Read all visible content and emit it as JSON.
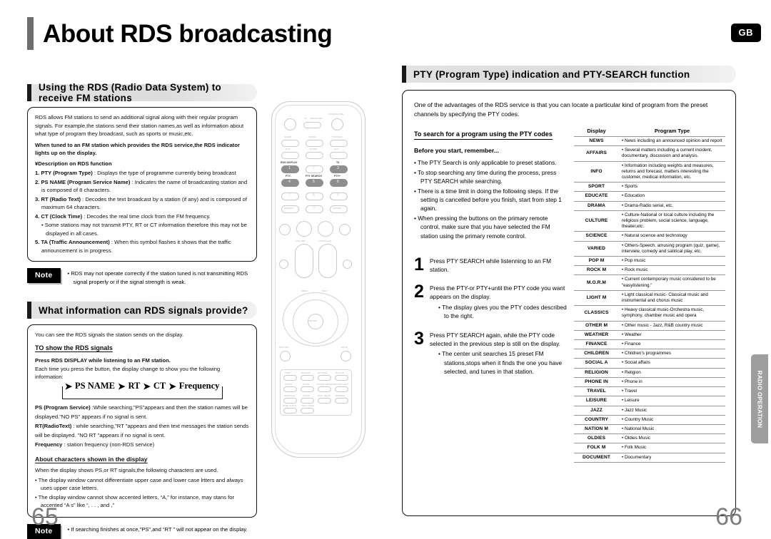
{
  "header": {
    "title": "About RDS broadcasting",
    "region_badge": "GB"
  },
  "side_tab": {
    "label": "RADIO OPERATION"
  },
  "footer": {
    "page_left": "65",
    "page_right": "66"
  },
  "left_column": {
    "section1": {
      "heading": "Using the RDS (Radio Data System) to receive FM stations",
      "intro1": "RDS allows FM stations to send an additional signal along with their regular program signals. For example,the stations send their station names,as well as information about what  type of program they broadcast, such as sports or music,etc.",
      "intro2": "When tuned to an FM station which provides the RDS service,the RDS indicator lights up on the display.",
      "desc_heading": "¥Description on RDS function",
      "items": [
        {
          "num": "1.",
          "bold": "PTY (Program Type)",
          "text": " : Displays the type of programme currently being broadcast"
        },
        {
          "num": "2.",
          "bold": "PS NAME (Program Service Name)",
          "text": " : Indicates the name of broadcasting station and is composed of 8 characters."
        },
        {
          "num": "3.",
          "bold": "RT (Radio Text)",
          "text": " : Decodes the text broadcast by a station (if any) and is composed of maximum 64 characters."
        },
        {
          "num": "4.",
          "bold": "CT (Clock Time)",
          "text": " : Decodes the real time clock from the FM frequency."
        }
      ],
      "sub_item": "• Some stations may not transmit PTY, RT or CT information therefore this may not be displayed in all cases.",
      "item5": {
        "num": "5.",
        "bold": "TA (Traffic Announcement)",
        "text": " : When this symbol flashes it shows that the traffic announcement is in progress."
      },
      "note_label": "Note",
      "note_text": "• RDS may not operate correctly if the station tuned is not transmitting RDS signal properly or if the signal strength is weak."
    },
    "section2": {
      "heading": "What information can RDS signals provide?",
      "intro": "You can see the RDS signals the station sends on the display.",
      "sub_head_1": "TO show the RDS signals",
      "press_line": "Press RDS DISPLAY while listening to an FM station.",
      "press_sub": "Each time you press the button, the display change to show you the following information:",
      "flow": [
        "PS NAME",
        "RT",
        "CT",
        "Frequency"
      ],
      "ps_bold": "PS (Program Service)",
      "ps_text": " :While searching,\"PS\"appears and then the station names will be displayed.\"NO PS\" appears if no signal is sent.",
      "rt_bold": "RT(RadioText)",
      "rt_text": " : while searching,\"RT \"appears and then text messages the station sends will be displayed. \"NO RT \"appears if no signal is sent.",
      "freq_bold": "Frequency",
      "freq_text": " : station frequency (non-RDS service)",
      "sub_head_2": "About characters shown in the display",
      "chars_intro": "When the display shows PS,or RT signals,the following characters are used.",
      "chars_b1": "• The display window cannot differentiate upper case and lower case lrtters and always uses upper case letters.",
      "chars_b2": "• The display window  cannot show accented letters, “A,” for instance, may stans for accented “A s” like “,  .  .  ,  and                    ,”",
      "note_label": "Note",
      "note_text": "• If searching finishes at once,\"PS\",and “RT ” will not appear on the display."
    }
  },
  "remote": {
    "top_labels": [
      "OPEN/CLOSE",
      "TV",
      "RECEIVER"
    ],
    "row_labels_1": [
      "SLEEP",
      "MODE",
      "TV/VIDEO"
    ],
    "row_labels_1b": [
      "DVD",
      "TUNER",
      "AUX"
    ],
    "highlight_labels": [
      "RDS DISPLAY",
      "TA",
      "PTY-",
      "PTY SEARCH",
      "PTY+"
    ],
    "numbers": [
      "1",
      "2",
      "3",
      "4",
      "5",
      "6",
      "7",
      "8",
      "9",
      "0"
    ],
    "extra_labels": [
      "REMAIN",
      "CANCEL",
      "VOLUME",
      "TUNING/CH",
      "RETURN",
      "MUTE",
      "ENTER",
      "MENU",
      "INFO"
    ],
    "bottom_labels": [
      "STEP",
      "REPEAT",
      "EZ VIEW",
      "P/SCAN",
      "ZOOM",
      "SLOW",
      "TUNER MEMORY",
      "SOUND EDIT",
      "SUBTITLE",
      "AUDIO",
      "DISC MENU",
      "DIMMER",
      "HDMI AUDIO",
      "TEST TONE"
    ]
  },
  "right_column": {
    "heading": "PTY (Program Type) indication and PTY-SEARCH function",
    "intro": "One  of the advantages of the RDS service is that you can locate a particular kind of program from the preset channels by specifying the PTY codes.",
    "sub_head": "To search for a program using the PTY codes",
    "before_head": "Before you start, remember...",
    "before_bullets": [
      "• The PTY Search is only applicable to preset stations.",
      "• To stop searching any time during the process, press PTY SEARCH while searching.",
      "• There is a time limit in doing the following steps. If the setting is cancelled before you finish, start from step 1 again.",
      "• When pressing the buttons on the primary remote control, make sure that you have selected the FM station using the primary remote control."
    ],
    "steps": [
      {
        "num": "1",
        "text": "Press PTY SEARCH while listenning to an FM station.",
        "sub": []
      },
      {
        "num": "2",
        "text": "Press the PTY-or PTY+until the PTY code you want appears on the display.",
        "sub": [
          "• The display gives you the PTY codes described to the right."
        ]
      },
      {
        "num": "3",
        "text": "Press PTY SEARCH again, while the PTY code selected in the previous step is still on the display.",
        "sub": [
          "• The center unit searches 15 preset FM stations,stops when it finds the one you have selected, and tunes in that station."
        ]
      }
    ],
    "table": {
      "headers": [
        "Display",
        "Program Type"
      ],
      "rows": [
        [
          "NEWS",
          "• News including an announced opinion and report"
        ],
        [
          "AFFAIRS",
          "• Several matters including a current incident, documentary, discussion and analysis."
        ],
        [
          "INFO",
          "•  Information including weights and measures, returns and forecast, matters interesting the customer, medical information, etc."
        ],
        [
          "SPORT",
          "• Sports"
        ],
        [
          "EDUCATE",
          "• Education"
        ],
        [
          "DRAMA",
          "• Drama-Radio serial, etc."
        ],
        [
          "CULTURE",
          "• Culture-National or local culture including the religious problem, social science, language, theater,etc."
        ],
        [
          "SCIENCE",
          "• Natural science and technology"
        ],
        [
          "VARIED",
          "• Others-Speech, amusing program (quiz, game), interview, comedy and satirical play, etc."
        ],
        [
          "POP M",
          "• Pop music"
        ],
        [
          "ROCK M",
          "• Rock music"
        ],
        [
          "M.O.R.M",
          "• Current contemporary music considered to be “easylistening.”"
        ],
        [
          "LIGHT M",
          "• Light classical music- Classical music and instrumental and chorus music"
        ],
        [
          "CLASSICS",
          "• Heavy classical  music-Orchestra music, symphony, chamber music and opera"
        ],
        [
          "OTHER M",
          "• Other music - Jazz, R&B country music"
        ],
        [
          "WEATHER",
          "• Weather"
        ],
        [
          "FINANCE",
          "• Finance"
        ],
        [
          "CHILDREN",
          "• Children’s programmes"
        ],
        [
          "SOCIAL A",
          "• Social affairs"
        ],
        [
          "RELIGION",
          "• Religion"
        ],
        [
          "PHONE IN",
          "• Phone in"
        ],
        [
          "TRAVEL",
          "• Travel"
        ],
        [
          "LEISURE",
          "• Leisure"
        ],
        [
          "JAZZ",
          "• Jazz Music"
        ],
        [
          "COUNTRY",
          "• Country Music"
        ],
        [
          "NATION M",
          "• National Music"
        ],
        [
          "OLDIES",
          "• Oldies Music"
        ],
        [
          "FOLK M",
          "• Folk Music"
        ],
        [
          "DOCUMENT",
          "• Documentary"
        ]
      ]
    }
  }
}
